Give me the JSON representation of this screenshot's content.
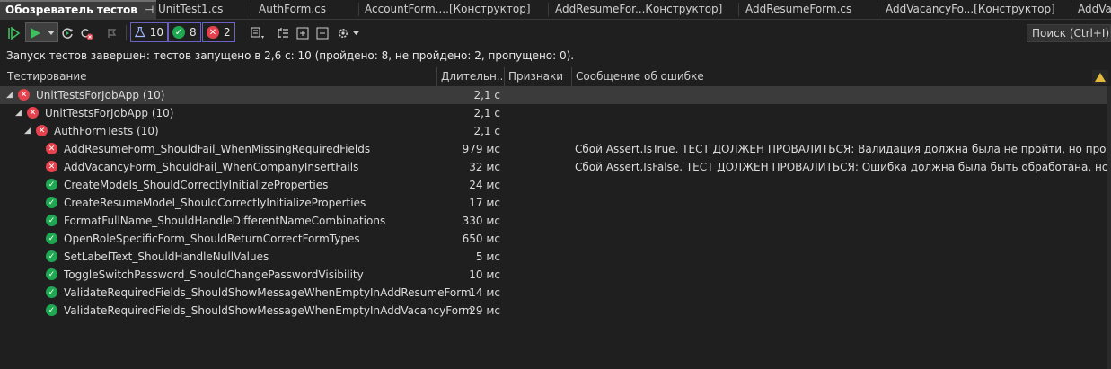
{
  "tabs": [
    {
      "label": "Обозреватель тестов",
      "active": true
    },
    {
      "label": "UnitTest1.cs"
    },
    {
      "label": "AuthForm.cs"
    },
    {
      "label": "AccountForm....[Конструктор]"
    },
    {
      "label": "AddResumeFor...Конструктор]"
    },
    {
      "label": "AddResumeForm.cs"
    },
    {
      "label": "AddVacancyFo...[Конструктор]"
    },
    {
      "label": "AddVac"
    }
  ],
  "tab_pin_glyph": "⊣",
  "tab_close_glyph": "✕",
  "toolbar": {
    "total_count": "10",
    "passed_count": "8",
    "failed_count": "2",
    "search_placeholder": "Поиск (Ctrl+I)"
  },
  "status_text": "Запуск тестов завершен: тестов запущено в 2,6 с: 10 (пройдено: 8, не пройдено: 2, пропущено: 0).",
  "columns": {
    "test": "Тестирование",
    "duration": "Длительн...",
    "traits": "Признаки",
    "error": "Сообщение об ошибке"
  },
  "rows": [
    {
      "name": "UnitTestsForJobApp  (10)",
      "duration": "2,1 с",
      "status": "fail",
      "level": 0,
      "expanded": true,
      "selected": true,
      "message": ""
    },
    {
      "name": "UnitTestsForJobApp  (10)",
      "duration": "2,1 с",
      "status": "fail",
      "level": 1,
      "expanded": true,
      "message": ""
    },
    {
      "name": "AuthFormTests  (10)",
      "duration": "2,1 с",
      "status": "fail",
      "level": 2,
      "expanded": true,
      "message": ""
    },
    {
      "name": "AddResumeForm_ShouldFail_WhenMissingRequiredFields",
      "duration": "979 мс",
      "status": "fail",
      "level": 3,
      "message": "Сбой Assert.IsTrue. ТЕСТ ДОЛЖЕН ПРОВАЛИТЬСЯ: Валидация должна была не пройти, но прошла"
    },
    {
      "name": "AddVacancyForm_ShouldFail_WhenCompanyInsertFails",
      "duration": "32 мс",
      "status": "fail",
      "level": 3,
      "message": "Сбой Assert.IsFalse. ТЕСТ ДОЛЖЕН ПРОВАЛИТЬСЯ: Ошибка должна была быть обработана, но не была"
    },
    {
      "name": "CreateModels_ShouldCorrectlyInitializeProperties",
      "duration": "24 мс",
      "status": "pass",
      "level": 3,
      "message": ""
    },
    {
      "name": "CreateResumeModel_ShouldCorrectlyInitializeProperties",
      "duration": "17 мс",
      "status": "pass",
      "level": 3,
      "message": ""
    },
    {
      "name": "FormatFullName_ShouldHandleDifferentNameCombinations",
      "duration": "330 мс",
      "status": "pass",
      "level": 3,
      "message": ""
    },
    {
      "name": "OpenRoleSpecificForm_ShouldReturnCorrectFormTypes",
      "duration": "650 мс",
      "status": "pass",
      "level": 3,
      "message": ""
    },
    {
      "name": "SetLabelText_ShouldHandleNullValues",
      "duration": "5 мс",
      "status": "pass",
      "level": 3,
      "message": ""
    },
    {
      "name": "ToggleSwitchPassword_ShouldChangePasswordVisibility",
      "duration": "10 мс",
      "status": "pass",
      "level": 3,
      "message": ""
    },
    {
      "name": "ValidateRequiredFields_ShouldShowMessageWhenEmptyInAddResumeForm",
      "duration": "14 мс",
      "status": "pass",
      "level": 3,
      "message": ""
    },
    {
      "name": "ValidateRequiredFields_ShouldShowMessageWhenEmptyInAddVacancyForm",
      "duration": "29 мс",
      "status": "pass",
      "level": 3,
      "message": ""
    }
  ],
  "colors": {
    "fail": "#e5424d",
    "pass": "#1fa751",
    "accent": "#6b62c6"
  }
}
